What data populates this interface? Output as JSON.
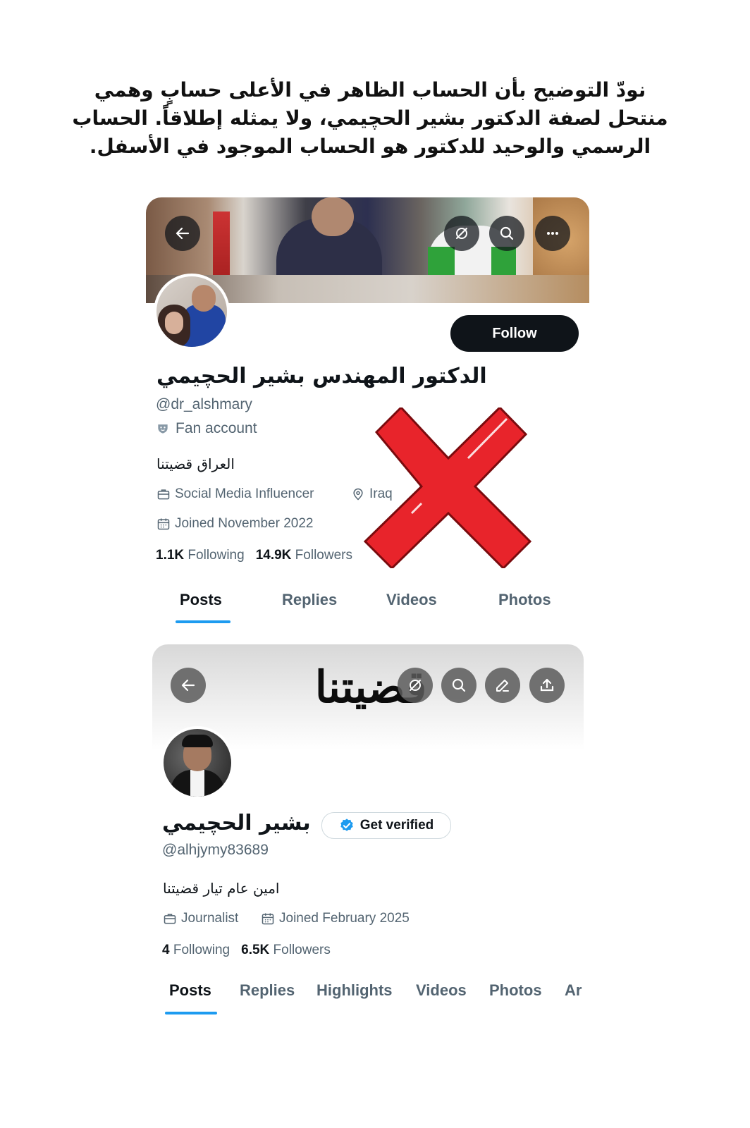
{
  "notice": {
    "text": "نودّ التوضيح بأن الحساب الظاهر في الأعلى حسابٍ وهمي منتحل لصفة الدكتور بشير الحچيمي، ولا يمثله إطلاقاً. الحساب الرسمي والوحيد للدكتور هو الحساب الموجود في الأسفل."
  },
  "fake_profile": {
    "follow_label": "Follow",
    "display_name": "الدكتور المهندس بشير الحچيمي",
    "handle": "@dr_alshmary",
    "fan_account": "Fan account",
    "bio": "العراق قضيتنا",
    "profession": "Social Media Influencer",
    "location": "Iraq",
    "joined": "Joined November 2022",
    "following_count": "1.1K",
    "following_label": "Following",
    "followers_count": "14.9K",
    "followers_label": "Followers",
    "tabs": [
      "Posts",
      "Replies",
      "Videos",
      "Photos"
    ],
    "active_tab": "Posts"
  },
  "official_profile": {
    "banner_text": "قضيتنا",
    "display_name": "بشير الحچيمي",
    "get_verified_label": "Get verified",
    "handle": "@alhjymy83689",
    "bio": "امين عام تيار قضيتنا",
    "profession": "Journalist",
    "joined": "Joined February 2025",
    "following_count": "4",
    "following_label": "Following",
    "followers_count": "6.5K",
    "followers_label": "Followers",
    "tabs": [
      "Posts",
      "Replies",
      "Highlights",
      "Videos",
      "Photos",
      "Ar"
    ],
    "active_tab": "Posts"
  },
  "colors": {
    "accent": "#1d9bf0",
    "text_primary": "#0f1419",
    "text_secondary": "#536471",
    "red_x": "#e8242b"
  }
}
